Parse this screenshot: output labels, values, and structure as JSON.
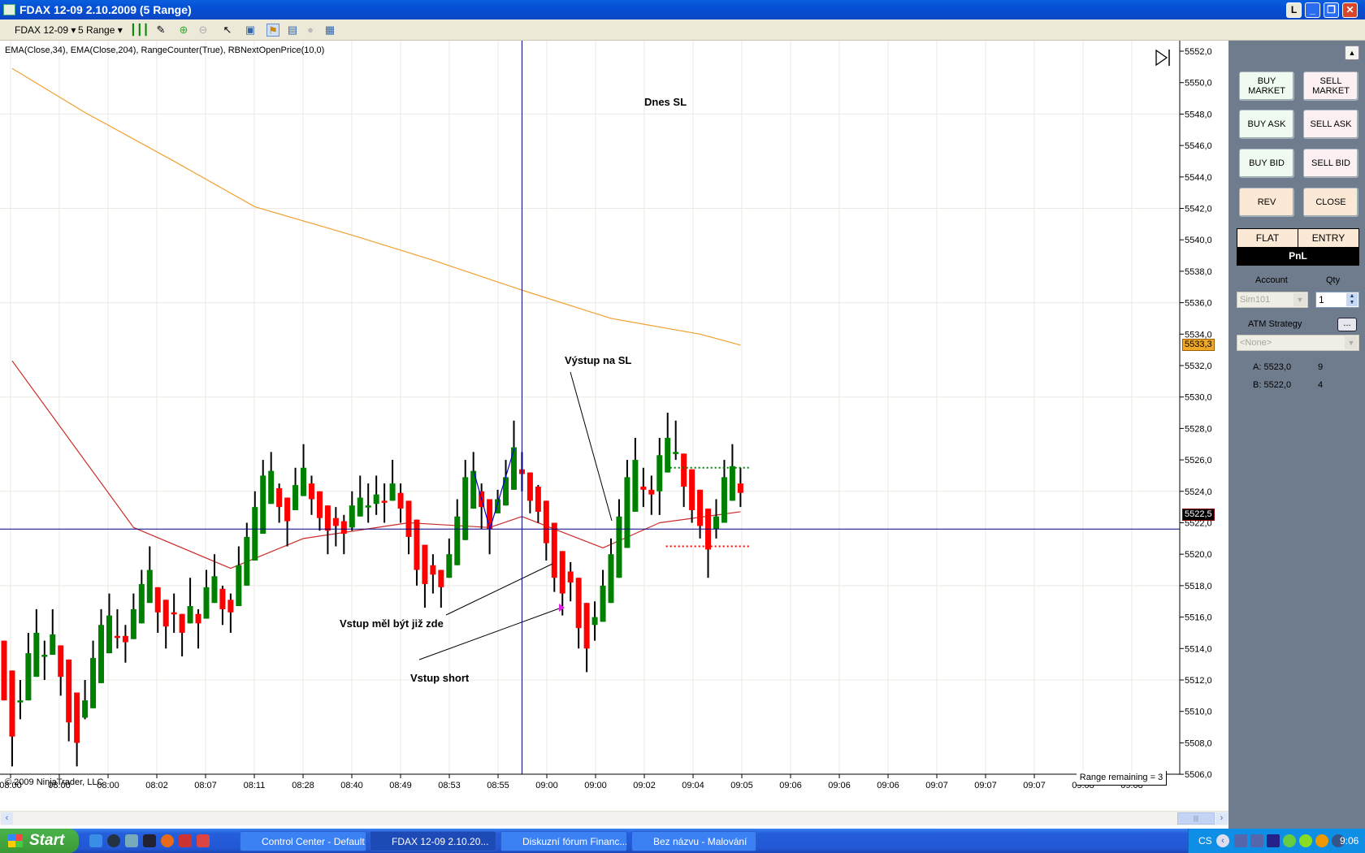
{
  "window": {
    "title": "FDAX 12-09  2.10.2009 (5 Range)",
    "buttons": {
      "l": "L",
      "minimize": "_",
      "restore": "❐",
      "close": "✕"
    }
  },
  "toolbar": {
    "instrument": "FDAX 12-09",
    "period": "5 Range",
    "icons": [
      "candlestick-icon",
      "pencil-icon",
      "zoom-in-icon",
      "zoom-out-icon",
      "cursor-icon",
      "properties-icon",
      "data-box-icon",
      "chart-trader-icon",
      "globe-icon",
      "table-icon"
    ]
  },
  "chart": {
    "indicators_label": "EMA(Close,34), EMA(Close,204), RangeCounter(True), RBNextOpenPrice(10,0)",
    "copyright": "© 2009 NinjaTrader, LLC",
    "range_remaining": "Range remaining = 3",
    "annotations": {
      "dnes_sl": "Dnes SL",
      "vystup_na_sl": "Výstup na SL",
      "vstup_mel": "Vstup měl být již zde",
      "vstup_short": "Vstup short"
    },
    "price_tags": {
      "ema204": "5533,3",
      "last": "5522,5"
    },
    "colors": {
      "up": "#008000",
      "down": "#ff0000",
      "ema34": "#cc2a2a",
      "ema204": "#f0a030",
      "crosshair": "#000080"
    }
  },
  "chart_data": {
    "type": "candlestick",
    "ylim": [
      5505,
      5552.6
    ],
    "yticks": [
      5506,
      5508,
      5510,
      5512,
      5514,
      5516,
      5518,
      5520,
      5522,
      5524,
      5526,
      5528,
      5530,
      5532,
      5534,
      5536,
      5538,
      5540,
      5542,
      5544,
      5546,
      5548,
      5550,
      5552
    ],
    "ytick_labels": [
      "5506,0",
      "5508,0",
      "5510,0",
      "5512,0",
      "5514,0",
      "5516,0",
      "5518,0",
      "5520,0",
      "5522,0",
      "5524,0",
      "5526,0",
      "5528,0",
      "5530,0",
      "5532,0",
      "5534,0",
      "5536,0",
      "5538,0",
      "5540,0",
      "5542,0",
      "5544,0",
      "5546,0",
      "5548,0",
      "5550,0",
      "5552,0"
    ],
    "ygrid": [
      5506,
      5512,
      5518,
      5524,
      5530,
      5536,
      5542,
      5548
    ],
    "xtick_labels": [
      "08:00",
      "08:00",
      "08:00",
      "08:02",
      "08:07",
      "08:11",
      "08:28",
      "08:40",
      "08:49",
      "08:53",
      "08:55",
      "09:00",
      "09:00",
      "09:02",
      "09:04",
      "09:05",
      "09:06",
      "09:06",
      "09:06",
      "09:07",
      "09:07",
      "09:07",
      "09:08",
      "09:08"
    ],
    "ohlc_fields": [
      "open",
      "high",
      "low",
      "close"
    ],
    "bars": [
      [
        5514.5,
        5514.5,
        5510.7,
        5510.7
      ],
      [
        5512.6,
        5512.6,
        5506.5,
        5508.4
      ],
      [
        5510.6,
        5512.0,
        5509.5,
        5510.7
      ],
      [
        5510.7,
        5515.0,
        5510.7,
        5513.7
      ],
      [
        5512.2,
        5516.5,
        5512.2,
        5515.0
      ],
      [
        5513.5,
        5514.5,
        5512.0,
        5513.6
      ],
      [
        5513.6,
        5516.5,
        5513.6,
        5514.9
      ],
      [
        5514.2,
        5514.2,
        5511.0,
        5512.2
      ],
      [
        5513.3,
        5513.3,
        5508.1,
        5509.3
      ],
      [
        5511.2,
        5511.2,
        5506.5,
        5508.0
      ],
      [
        5509.6,
        5512.0,
        5509.5,
        5510.7
      ],
      [
        5510.2,
        5514.5,
        5510.2,
        5513.4
      ],
      [
        5511.8,
        5516.5,
        5511.8,
        5515.5
      ],
      [
        5513.7,
        5517.5,
        5513.7,
        5516.1
      ],
      [
        5514.8,
        5516.5,
        5514.0,
        5514.7
      ],
      [
        5514.8,
        5515.5,
        5513.1,
        5514.4
      ],
      [
        5514.6,
        5517.5,
        5514.6,
        5516.5
      ],
      [
        5515.6,
        5519.0,
        5515.6,
        5518.1
      ],
      [
        5516.9,
        5520.5,
        5516.9,
        5519.0
      ],
      [
        5517.9,
        5517.9,
        5515.0,
        5516.3
      ],
      [
        5517.1,
        5517.1,
        5514.0,
        5515.4
      ],
      [
        5516.3,
        5517.5,
        5515.0,
        5516.2
      ],
      [
        5516.2,
        5516.2,
        5513.5,
        5515.0
      ],
      [
        5515.6,
        5518.5,
        5515.6,
        5516.7
      ],
      [
        5516.2,
        5516.5,
        5514.0,
        5515.6
      ],
      [
        5515.9,
        5519.0,
        5515.9,
        5517.9
      ],
      [
        5516.9,
        5520.0,
        5516.9,
        5518.6
      ],
      [
        5517.8,
        5518.0,
        5515.5,
        5516.5
      ],
      [
        5517.1,
        5517.5,
        5515.0,
        5516.3
      ],
      [
        5516.7,
        5520.5,
        5516.7,
        5519.3
      ],
      [
        5518.0,
        5522.0,
        5518.0,
        5521.1
      ],
      [
        5519.6,
        5524.0,
        5519.6,
        5523.0
      ],
      [
        5521.3,
        5526.0,
        5521.3,
        5525.0
      ],
      [
        5523.2,
        5526.5,
        5523.2,
        5525.3
      ],
      [
        5524.2,
        5524.5,
        5522.0,
        5523.0
      ],
      [
        5523.6,
        5523.6,
        5520.5,
        5522.1
      ],
      [
        5522.8,
        5525.5,
        5522.8,
        5524.4
      ],
      [
        5523.7,
        5527.0,
        5523.7,
        5525.5
      ],
      [
        5524.5,
        5525.0,
        5522.5,
        5523.5
      ],
      [
        5524.0,
        5524.0,
        5521.5,
        5522.3
      ],
      [
        5523.1,
        5523.1,
        5520.0,
        5521.5
      ],
      [
        5522.3,
        5523.0,
        5520.5,
        5521.8
      ],
      [
        5522.1,
        5522.5,
        5520.0,
        5521.3
      ],
      [
        5521.7,
        5524.0,
        5521.5,
        5523.1
      ],
      [
        5522.4,
        5525.0,
        5522.4,
        5523.6
      ],
      [
        5523.0,
        5524.5,
        5522.0,
        5523.1
      ],
      [
        5523.2,
        5525.0,
        5522.5,
        5523.8
      ],
      [
        5523.4,
        5524.5,
        5522.0,
        5523.3
      ],
      [
        5523.4,
        5526.0,
        5523.4,
        5524.5
      ],
      [
        5523.9,
        5524.5,
        5522.0,
        5522.9
      ],
      [
        5523.4,
        5523.4,
        5520.0,
        5521.1
      ],
      [
        5522.2,
        5522.2,
        5518.0,
        5519.0
      ],
      [
        5520.6,
        5520.6,
        5516.6,
        5518.1
      ],
      [
        5519.3,
        5520.0,
        5517.5,
        5518.7
      ],
      [
        5519.0,
        5519.0,
        5516.6,
        5517.9
      ],
      [
        5518.5,
        5521.0,
        5518.5,
        5520.0
      ],
      [
        5519.3,
        5523.5,
        5519.3,
        5522.4
      ],
      [
        5520.9,
        5526.0,
        5520.9,
        5524.9
      ],
      [
        5522.9,
        5526.5,
        5522.9,
        5525.3
      ],
      [
        5524.0,
        5524.5,
        5521.6,
        5523.0
      ],
      [
        5523.5,
        5523.5,
        5520.0,
        5521.6
      ],
      [
        5522.6,
        5524.1,
        5522.6,
        5523.5
      ],
      [
        5523.1,
        5526.0,
        5523.1,
        5524.9
      ],
      [
        5524.1,
        5528.5,
        5524.1,
        5526.8
      ],
      [
        5525.4,
        5526.5,
        5524.0,
        5525.1
      ],
      [
        5525.2,
        5525.2,
        5522.6,
        5523.4
      ],
      [
        5524.3,
        5524.4,
        5522.0,
        5522.7
      ],
      [
        5523.4,
        5523.4,
        5519.6,
        5520.7
      ],
      [
        5522.0,
        5522.0,
        5517.6,
        5518.5
      ],
      [
        5520.2,
        5520.2,
        5516.1,
        5517.5
      ],
      [
        5518.9,
        5519.5,
        5517.0,
        5518.2
      ],
      [
        5518.5,
        5518.5,
        5514.0,
        5515.3
      ],
      [
        5516.9,
        5516.9,
        5512.5,
        5514.0
      ],
      [
        5515.5,
        5517.0,
        5514.5,
        5516.0
      ],
      [
        5515.7,
        5519.0,
        5515.7,
        5518.0
      ],
      [
        5516.9,
        5521.0,
        5516.9,
        5520.0
      ],
      [
        5518.5,
        5523.5,
        5518.5,
        5522.4
      ],
      [
        5520.4,
        5526.0,
        5520.4,
        5524.9
      ],
      [
        5522.7,
        5527.4,
        5522.7,
        5526.0
      ],
      [
        5524.3,
        5525.5,
        5523.0,
        5524.1
      ],
      [
        5524.1,
        5525.0,
        5522.5,
        5523.8
      ],
      [
        5524.0,
        5527.4,
        5522.5,
        5526.3
      ],
      [
        5525.2,
        5529.0,
        5525.2,
        5527.4
      ],
      [
        5526.4,
        5528.5,
        5526.0,
        5526.5
      ],
      [
        5526.4,
        5526.4,
        5523.0,
        5524.3
      ],
      [
        5525.4,
        5525.4,
        5522.0,
        5522.8
      ],
      [
        5524.1,
        5524.1,
        5521.0,
        5521.8
      ],
      [
        5522.9,
        5522.9,
        5518.5,
        5520.3
      ],
      [
        5521.6,
        5523.5,
        5521.0,
        5522.4
      ],
      [
        5522.0,
        5526.0,
        5522.0,
        5524.9
      ],
      [
        5523.4,
        5527.0,
        5523.4,
        5525.6
      ],
      [
        5524.5,
        5525.5,
        5523.0,
        5523.9
      ]
    ],
    "ema34": {
      "bar_index": [
        1,
        16,
        28,
        37,
        50,
        60,
        64,
        74,
        81,
        91
      ],
      "value": [
        5532.3,
        5521.7,
        5519.1,
        5521.0,
        5522.0,
        5521.7,
        5522.4,
        5520.4,
        5522.0,
        5522.7
      ]
    },
    "ema204": {
      "bar_index": [
        1,
        10,
        21,
        31,
        43,
        53,
        64,
        75,
        86,
        91
      ],
      "value": [
        5550.9,
        5548.1,
        5545.0,
        5542.1,
        5540.3,
        5538.7,
        5536.8,
        5535.0,
        5534.0,
        5533.3
      ]
    },
    "last_price": 5522.5,
    "ema204_last": 5533.3,
    "crosshair": {
      "bar_index": 64,
      "price": 5521.6
    },
    "stop_levels": {
      "target": 5525.5,
      "stop": 5520.5,
      "from_bar": 83,
      "to_bar": 92
    }
  },
  "panel": {
    "buttons": {
      "buy_market": "BUY\nMARKET",
      "sell_market": "SELL\nMARKET",
      "buy_ask": "BUY ASK",
      "sell_ask": "SELL ASK",
      "buy_bid": "BUY BID",
      "sell_bid": "SELL BID",
      "rev": "REV",
      "close": "CLOSE"
    },
    "flat": "FLAT",
    "entry": "ENTRY",
    "pnl": "PnL",
    "account_label": "Account",
    "account_value": "Sim101",
    "qty_label": "Qty",
    "qty_value": "1",
    "atm_label": "ATM Strategy",
    "atm_btn": "...",
    "atm_value": "<None>",
    "ask": "A: 5523,0",
    "ask_size": "9",
    "bid": "B: 5522,0",
    "bid_size": "4"
  },
  "taskbar": {
    "start": "Start",
    "tasks": [
      "Control Center - Default",
      "FDAX 12-09  2.10.20...",
      "Diskuzní fórum Financ...",
      "Bez názvu - Malování"
    ],
    "lang": "CS",
    "clock": "9:06"
  }
}
